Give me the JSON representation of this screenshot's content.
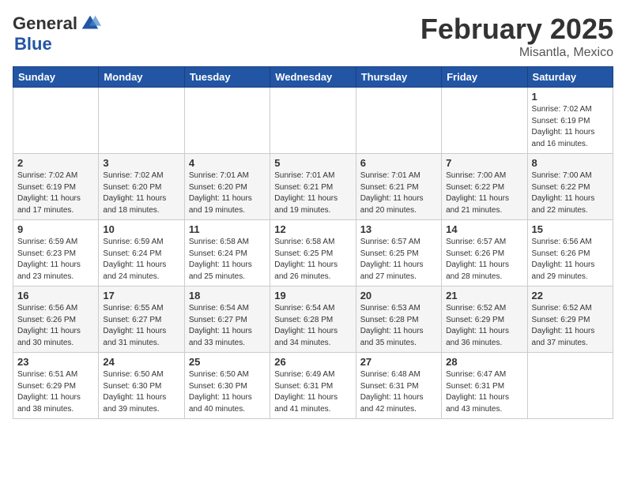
{
  "header": {
    "logo_general": "General",
    "logo_blue": "Blue",
    "month_year": "February 2025",
    "location": "Misantla, Mexico"
  },
  "weekdays": [
    "Sunday",
    "Monday",
    "Tuesday",
    "Wednesday",
    "Thursday",
    "Friday",
    "Saturday"
  ],
  "weeks": [
    [
      {
        "day": "",
        "info": ""
      },
      {
        "day": "",
        "info": ""
      },
      {
        "day": "",
        "info": ""
      },
      {
        "day": "",
        "info": ""
      },
      {
        "day": "",
        "info": ""
      },
      {
        "day": "",
        "info": ""
      },
      {
        "day": "1",
        "info": "Sunrise: 7:02 AM\nSunset: 6:19 PM\nDaylight: 11 hours\nand 16 minutes."
      }
    ],
    [
      {
        "day": "2",
        "info": "Sunrise: 7:02 AM\nSunset: 6:19 PM\nDaylight: 11 hours\nand 17 minutes."
      },
      {
        "day": "3",
        "info": "Sunrise: 7:02 AM\nSunset: 6:20 PM\nDaylight: 11 hours\nand 18 minutes."
      },
      {
        "day": "4",
        "info": "Sunrise: 7:01 AM\nSunset: 6:20 PM\nDaylight: 11 hours\nand 19 minutes."
      },
      {
        "day": "5",
        "info": "Sunrise: 7:01 AM\nSunset: 6:21 PM\nDaylight: 11 hours\nand 19 minutes."
      },
      {
        "day": "6",
        "info": "Sunrise: 7:01 AM\nSunset: 6:21 PM\nDaylight: 11 hours\nand 20 minutes."
      },
      {
        "day": "7",
        "info": "Sunrise: 7:00 AM\nSunset: 6:22 PM\nDaylight: 11 hours\nand 21 minutes."
      },
      {
        "day": "8",
        "info": "Sunrise: 7:00 AM\nSunset: 6:22 PM\nDaylight: 11 hours\nand 22 minutes."
      }
    ],
    [
      {
        "day": "9",
        "info": "Sunrise: 6:59 AM\nSunset: 6:23 PM\nDaylight: 11 hours\nand 23 minutes."
      },
      {
        "day": "10",
        "info": "Sunrise: 6:59 AM\nSunset: 6:24 PM\nDaylight: 11 hours\nand 24 minutes."
      },
      {
        "day": "11",
        "info": "Sunrise: 6:58 AM\nSunset: 6:24 PM\nDaylight: 11 hours\nand 25 minutes."
      },
      {
        "day": "12",
        "info": "Sunrise: 6:58 AM\nSunset: 6:25 PM\nDaylight: 11 hours\nand 26 minutes."
      },
      {
        "day": "13",
        "info": "Sunrise: 6:57 AM\nSunset: 6:25 PM\nDaylight: 11 hours\nand 27 minutes."
      },
      {
        "day": "14",
        "info": "Sunrise: 6:57 AM\nSunset: 6:26 PM\nDaylight: 11 hours\nand 28 minutes."
      },
      {
        "day": "15",
        "info": "Sunrise: 6:56 AM\nSunset: 6:26 PM\nDaylight: 11 hours\nand 29 minutes."
      }
    ],
    [
      {
        "day": "16",
        "info": "Sunrise: 6:56 AM\nSunset: 6:26 PM\nDaylight: 11 hours\nand 30 minutes."
      },
      {
        "day": "17",
        "info": "Sunrise: 6:55 AM\nSunset: 6:27 PM\nDaylight: 11 hours\nand 31 minutes."
      },
      {
        "day": "18",
        "info": "Sunrise: 6:54 AM\nSunset: 6:27 PM\nDaylight: 11 hours\nand 33 minutes."
      },
      {
        "day": "19",
        "info": "Sunrise: 6:54 AM\nSunset: 6:28 PM\nDaylight: 11 hours\nand 34 minutes."
      },
      {
        "day": "20",
        "info": "Sunrise: 6:53 AM\nSunset: 6:28 PM\nDaylight: 11 hours\nand 35 minutes."
      },
      {
        "day": "21",
        "info": "Sunrise: 6:52 AM\nSunset: 6:29 PM\nDaylight: 11 hours\nand 36 minutes."
      },
      {
        "day": "22",
        "info": "Sunrise: 6:52 AM\nSunset: 6:29 PM\nDaylight: 11 hours\nand 37 minutes."
      }
    ],
    [
      {
        "day": "23",
        "info": "Sunrise: 6:51 AM\nSunset: 6:29 PM\nDaylight: 11 hours\nand 38 minutes."
      },
      {
        "day": "24",
        "info": "Sunrise: 6:50 AM\nSunset: 6:30 PM\nDaylight: 11 hours\nand 39 minutes."
      },
      {
        "day": "25",
        "info": "Sunrise: 6:50 AM\nSunset: 6:30 PM\nDaylight: 11 hours\nand 40 minutes."
      },
      {
        "day": "26",
        "info": "Sunrise: 6:49 AM\nSunset: 6:31 PM\nDaylight: 11 hours\nand 41 minutes."
      },
      {
        "day": "27",
        "info": "Sunrise: 6:48 AM\nSunset: 6:31 PM\nDaylight: 11 hours\nand 42 minutes."
      },
      {
        "day": "28",
        "info": "Sunrise: 6:47 AM\nSunset: 6:31 PM\nDaylight: 11 hours\nand 43 minutes."
      },
      {
        "day": "",
        "info": ""
      }
    ]
  ]
}
